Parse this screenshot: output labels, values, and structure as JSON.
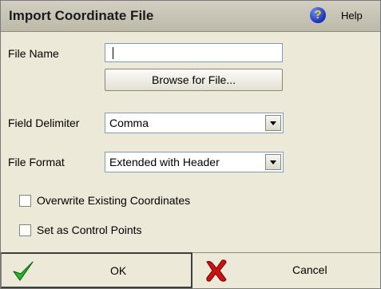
{
  "dialog": {
    "title": "Import Coordinate File",
    "help_label": "Help",
    "help_icon": "question-icon"
  },
  "file_name": {
    "label": "File Name",
    "value": "",
    "browse_label": "Browse for File..."
  },
  "field_delimiter": {
    "label": "Field Delimiter",
    "selected": "Comma"
  },
  "file_format": {
    "label": "File Format",
    "selected": "Extended with Header"
  },
  "options": [
    {
      "label": "Overwrite Existing Coordinates",
      "checked": false
    },
    {
      "label": "Set as Control Points",
      "checked": false
    }
  ],
  "buttons": {
    "ok_label": "OK",
    "cancel_label": "Cancel"
  },
  "colors": {
    "ok_check": "#2db52d",
    "cancel_x": "#cc1111",
    "help_badge": "#1a2fb8"
  }
}
